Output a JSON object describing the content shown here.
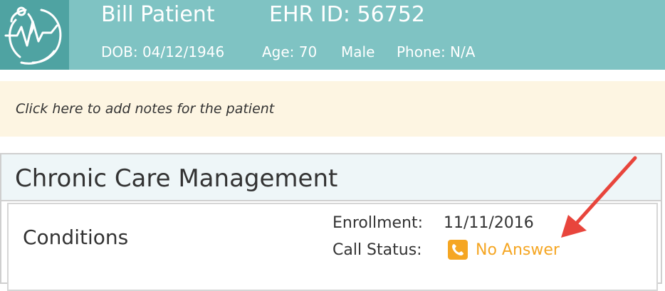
{
  "header": {
    "patient_name": "Bill Patient",
    "ehr_id": "EHR ID: 56752",
    "dob": "DOB: 04/12/1946",
    "age": "Age: 70",
    "sex": "Male",
    "phone": "Phone: N/A",
    "logo_icon": "globe-heartbeat-icon"
  },
  "notes": {
    "text": "Click here to add notes for the patient"
  },
  "ccm": {
    "title": "Chronic Care Management",
    "conditions_label": "Conditions",
    "enrollment_label": "Enrollment:",
    "enrollment_value": "11/11/2016",
    "call_status_label": "Call Status:",
    "call_status_value": "No Answer",
    "call_status_icon": "phone-icon"
  },
  "colors": {
    "header_bg": "#7fc3c3",
    "logo_bg": "#4fa3a2",
    "notes_bg": "#fdf5e2",
    "status_orange": "#f5a623",
    "annotation_red": "#e8453c"
  }
}
